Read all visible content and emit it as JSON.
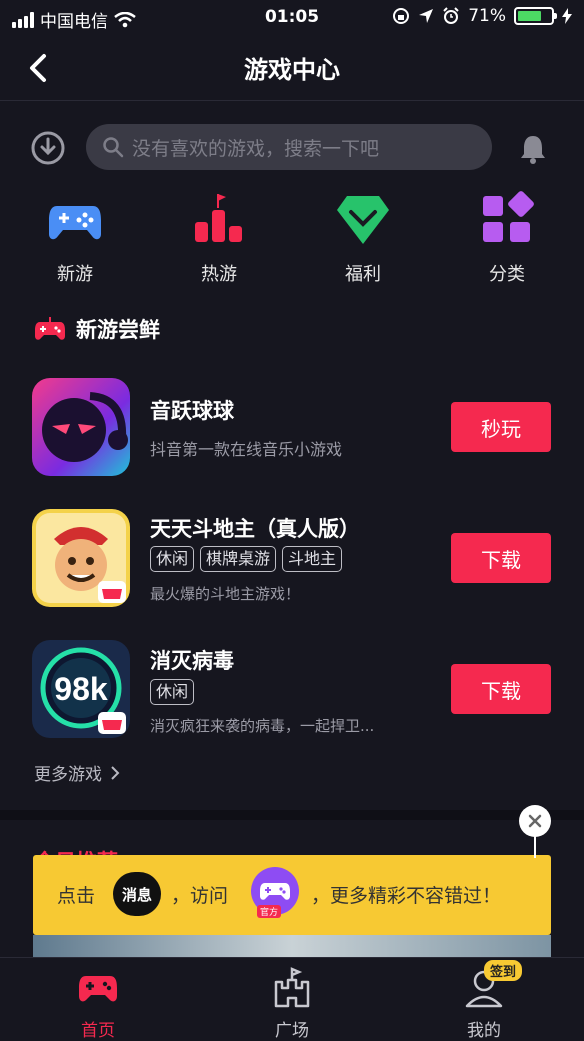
{
  "status_bar": {
    "carrier": "中国电信",
    "time": "01:05",
    "battery_text": "71%",
    "battery_level": 0.71
  },
  "nav": {
    "title": "游戏中心"
  },
  "search": {
    "placeholder": "没有喜欢的游戏，搜索一下吧"
  },
  "categories": [
    {
      "label": "新游",
      "icon": "gamepad-icon",
      "color": "#4a8ef5"
    },
    {
      "label": "热游",
      "icon": "chart-flag-icon",
      "color": "#f5294f"
    },
    {
      "label": "福利",
      "icon": "gift-gem-icon",
      "color": "#27c36b"
    },
    {
      "label": "分类",
      "icon": "grid-squares-icon",
      "color": "#b75cf0"
    }
  ],
  "section": {
    "title": "新游尝鲜"
  },
  "games": [
    {
      "title": "音跃球球",
      "tags": [],
      "desc": "抖音第一款在线音乐小游戏",
      "action": "秒玩"
    },
    {
      "title": "天天斗地主（真人版）",
      "tags": [
        "休闲",
        "棋牌桌游",
        "斗地主"
      ],
      "desc": "最火爆的斗地主游戏！",
      "action": "下载"
    },
    {
      "title": "消灭病毒",
      "tags": [
        "休闲"
      ],
      "desc": "消灭疯狂来袭的病毒，一起捍卫...",
      "action": "下载",
      "icon_text": "98k"
    }
  ],
  "more_games": "更多游戏",
  "today_title": "今日推荐",
  "banner": {
    "part1": "点击",
    "pill": "消息",
    "part2": "，访问",
    "official": "官方",
    "part3": "，更多精彩不容错过！"
  },
  "tabbar": {
    "home": "首页",
    "square": "广场",
    "mine": "我的",
    "signin": "签到"
  },
  "colors": {
    "accent": "#f5294f",
    "banner": "#f7c933",
    "background": "#16161f"
  }
}
